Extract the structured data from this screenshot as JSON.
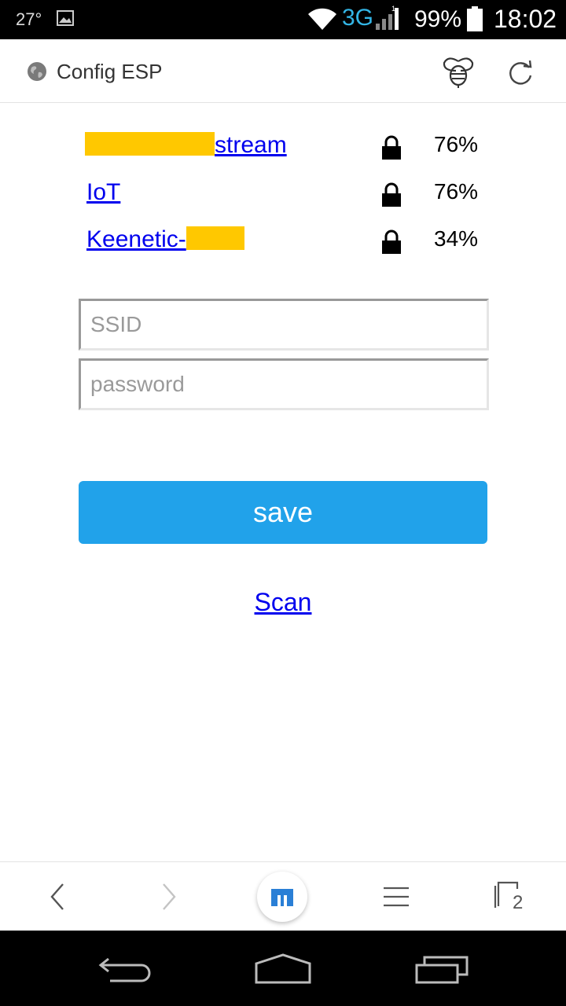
{
  "status_bar": {
    "temperature": "27°",
    "network_type": "3G",
    "signal_sub": "1",
    "battery": "99%",
    "time": "18:02"
  },
  "header": {
    "title": "Config ESP",
    "icons": [
      "globe-icon",
      "bee-icon",
      "reload-icon"
    ]
  },
  "networks": [
    {
      "name_visible": "stream",
      "signal": "76%",
      "secured": true
    },
    {
      "name_visible": "IoT",
      "signal": "76%",
      "secured": true
    },
    {
      "name_visible": "Keenetic-",
      "signal": "34%",
      "secured": true
    }
  ],
  "form": {
    "ssid_placeholder": "SSID",
    "ssid_value": "",
    "password_placeholder": "password",
    "password_value": "",
    "save_label": "save"
  },
  "scan_label": "Scan",
  "toolbar": {
    "tabs_count": "2",
    "icons": [
      "back-icon",
      "forward-icon",
      "maxthon-home-icon",
      "menu-icon",
      "tabs-icon"
    ]
  },
  "colors": {
    "accent": "#21a2ea",
    "link": "#0000ee",
    "redaction": "#ffc800",
    "network_type": "#33b5e5"
  }
}
